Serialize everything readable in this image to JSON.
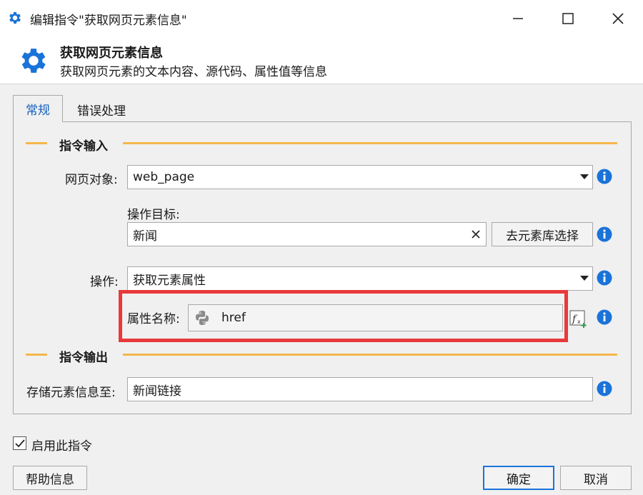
{
  "window": {
    "title": "编辑指令\"获取网页元素信息\"",
    "icons": {
      "app": "gear-icon",
      "minimize": "minimize-icon",
      "maximize": "maximize-icon",
      "close": "close-icon"
    }
  },
  "header": {
    "title": "获取网页元素信息",
    "subtitle": "获取网页元素的文本内容、源代码、属性值等信息"
  },
  "tabs": [
    {
      "label": "常规",
      "active": true
    },
    {
      "label": "错误处理",
      "active": false
    }
  ],
  "sections": {
    "input": "指令输入",
    "output": "指令输出"
  },
  "fields": {
    "web_object": {
      "label": "网页对象:",
      "value": "web_page"
    },
    "target": {
      "label": "操作目标:",
      "value": "新闻",
      "library_button": "去元素库选择"
    },
    "operation": {
      "label": "操作:",
      "value": "获取元素属性"
    },
    "attr_name": {
      "label": "属性名称:",
      "value": "href"
    },
    "store": {
      "label": "存储元素信息至:",
      "value": "新闻链接"
    }
  },
  "footer": {
    "enable_label": "启用此指令",
    "enabled": true,
    "help": "帮助信息",
    "ok": "确定",
    "cancel": "取消"
  },
  "colors": {
    "accent": "#1560bd",
    "info": "#1a73d9",
    "section_line": "#f5b74a",
    "highlight": "#e8393b"
  }
}
